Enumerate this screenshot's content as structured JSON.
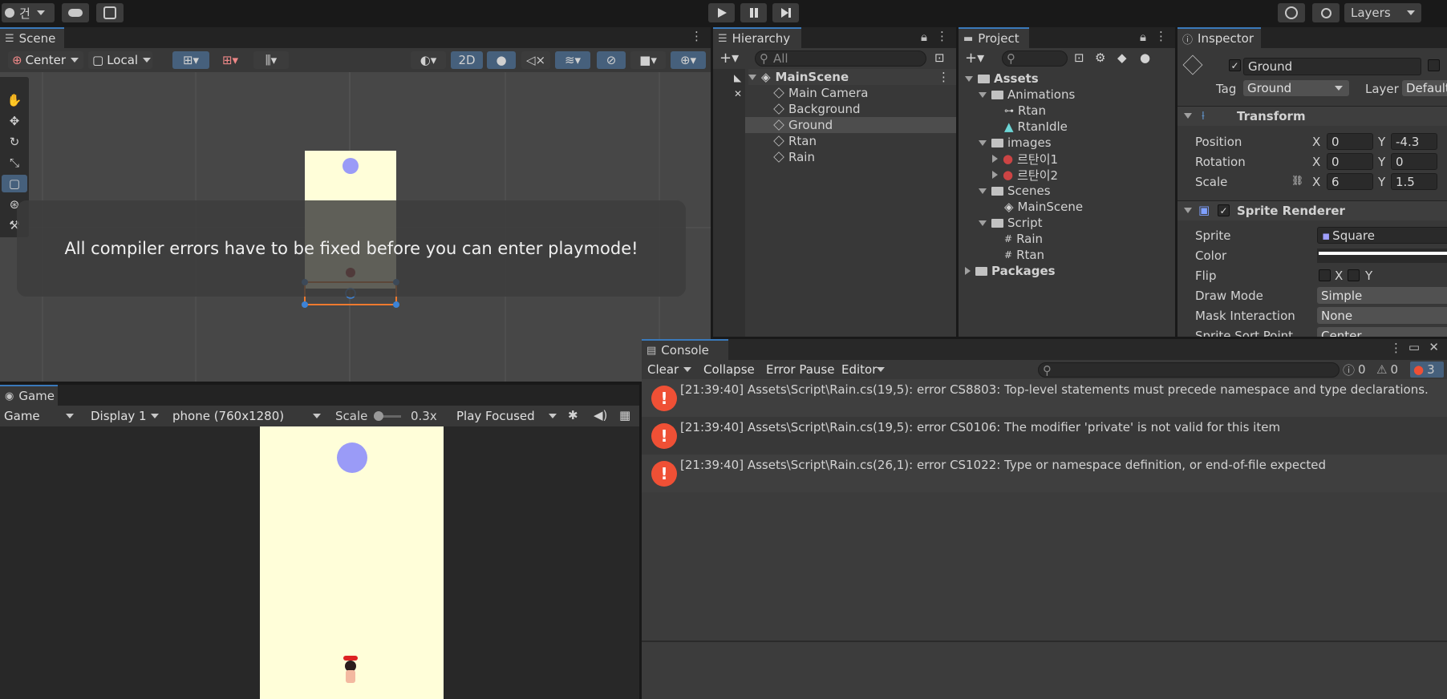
{
  "topbar": {
    "account_label": "건",
    "play_icon": "play-icon",
    "pause_icon": "pause-icon",
    "step_icon": "step-icon",
    "layers_label": "Layers"
  },
  "scene": {
    "tab_label": "Scene",
    "pivot_label": "Center",
    "space_label": "Local",
    "mode_2d_label": "2D",
    "overlay_message": "All compiler errors have to be fixed before you can enter playmode!"
  },
  "game": {
    "tab_label": "Game",
    "view_label": "Game",
    "display_label": "Display 1",
    "resolution_label": "phone (760x1280)",
    "scale_label": "Scale",
    "scale_value": "0.3x",
    "play_focused_label": "Play Focused"
  },
  "hierarchy": {
    "tab_label": "Hierarchy",
    "search_placeholder": "All",
    "scene_name": "MainScene",
    "items": [
      "Main Camera",
      "Background",
      "Ground",
      "Rtan",
      "Rain"
    ]
  },
  "project": {
    "tab_label": "Project",
    "assets_label": "Assets",
    "animations_label": "Animations",
    "anim_items": [
      "Rtan",
      "RtanIdle"
    ],
    "images_label": "images",
    "image_items": [
      "르탄이1",
      "르탄이2"
    ],
    "scenes_label": "Scenes",
    "scene_items": [
      "MainScene"
    ],
    "script_label": "Script",
    "script_items": [
      "Rain",
      "Rtan"
    ],
    "packages_label": "Packages"
  },
  "inspector": {
    "tab_label": "Inspector",
    "object_name": "Ground",
    "tag_label": "Tag",
    "tag_value": "Ground",
    "layer_label": "Layer",
    "layer_value": "Default",
    "transform_label": "Transform",
    "position_label": "Position",
    "rotation_label": "Rotation",
    "scale_label": "Scale",
    "x_label": "X",
    "y_label": "Y",
    "position": {
      "x": "0",
      "y": "-4.3"
    },
    "rotation": {
      "x": "0",
      "y": "0"
    },
    "scale": {
      "x": "6",
      "y": "1.5"
    },
    "sprite_renderer_label": "Sprite Renderer",
    "sprite_label": "Sprite",
    "sprite_value": "Square",
    "color_label": "Color",
    "flip_label": "Flip",
    "flip_x": "X",
    "flip_y": "Y",
    "draw_mode_label": "Draw Mode",
    "draw_mode_value": "Simple",
    "mask_label": "Mask Interaction",
    "mask_value": "None",
    "sort_label": "Sprite Sort Point",
    "sort_value": "Center"
  },
  "console": {
    "tab_label": "Console",
    "clear_label": "Clear",
    "collapse_label": "Collapse",
    "error_pause_label": "Error Pause",
    "editor_label": "Editor",
    "info_count": "0",
    "warn_count": "0",
    "error_count": "3",
    "messages": [
      "[21:39:40] Assets\\Script\\Rain.cs(19,5): error CS8803: Top-level statements must precede namespace and type declarations.",
      "[21:39:40] Assets\\Script\\Rain.cs(19,5): error CS0106: The modifier 'private' is not valid for this item",
      "[21:39:40] Assets\\Script\\Rain.cs(26,1): error CS1022: Type or namespace definition, or end-of-file expected"
    ]
  },
  "colors": {
    "accent": "#3a79bb",
    "error": "#ef5035",
    "game_bg": "#fffed9",
    "ball": "#9a9bf7"
  }
}
